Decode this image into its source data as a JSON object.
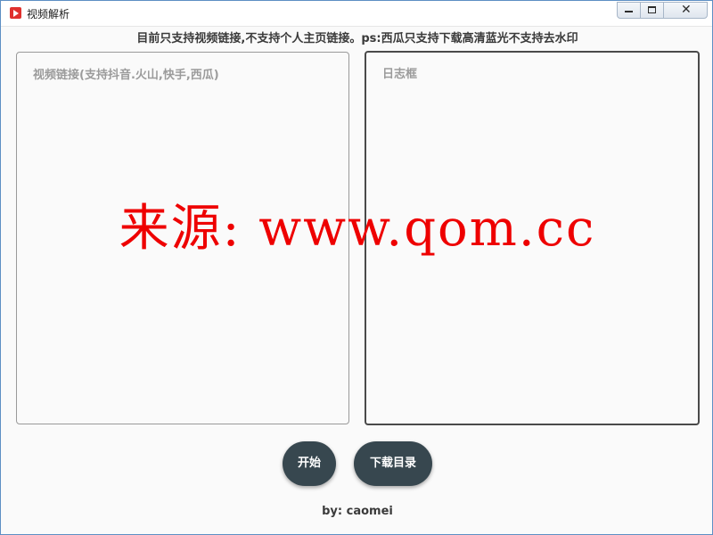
{
  "window": {
    "title": "视频解析",
    "app_icon": "video-play-icon",
    "controls": {
      "minimize": "minimize-icon",
      "maximize": "maximize-icon",
      "close": "close-icon",
      "close_glyph": "✕"
    }
  },
  "notice": "目前只支持视频链接,不支持个人主页链接。ps:西瓜只支持下载高清蓝光不支持去水印",
  "panels": {
    "link_input": {
      "placeholder": "视频链接(支持抖音.火山,快手,西瓜)",
      "value": ""
    },
    "log_box": {
      "placeholder": "日志框",
      "value": ""
    }
  },
  "watermark": "来源: www.qom.cc",
  "buttons": {
    "start": "开始",
    "download_dir": "下载目录"
  },
  "footer": "by: caomei",
  "colors": {
    "button_bg": "#37474f",
    "watermark": "#ee0000",
    "window_border": "#5d8fc4"
  }
}
